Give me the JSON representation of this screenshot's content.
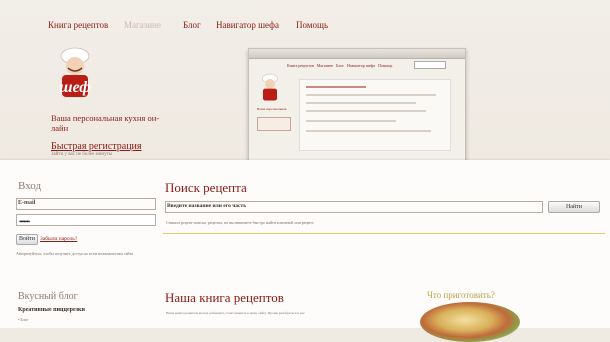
{
  "nav": {
    "items": [
      "Книга рецептов",
      "Магазине",
      "Блог",
      "Навигатор шефа",
      "Помощь"
    ]
  },
  "brand": {
    "logo_text": "шеф",
    "tagline": "Ваша персональная кухня он-лайн",
    "register": "Быстрая регистрация",
    "register_sub": "Зайти у вас не более минуты"
  },
  "login": {
    "heading": "Вход",
    "email_label": "E-mail",
    "password_mask": "•••••••",
    "login_button": "Войти",
    "forgot_link": "Забыли пароль?",
    "note": "Авторизуйтесь, чтобы получить доступ ко всем возможностям сайта"
  },
  "search": {
    "heading": "Поиск рецепта",
    "placeholder": "Введите название или его часть",
    "button": "Найти",
    "hint": "Сначала рецепт-поиска; рецепты, на вы начинаете быстро найти ключевой или рецепт."
  },
  "blog": {
    "heading": "Вкусный блог",
    "item_title": "Креативные пиццерезки",
    "item_sub": "• Блог"
  },
  "book": {
    "heading": "Наша книга рецептов",
    "sub": "Наша книга рецептов всегда добавляет, стоит рецепта к нему сайту. Проще разобраться в нас"
  },
  "aside": {
    "heading": "Что приготовить?"
  },
  "colors": {
    "accent": "#8b1a14",
    "muted": "#8d7d72",
    "rule": "#d9d16f"
  }
}
